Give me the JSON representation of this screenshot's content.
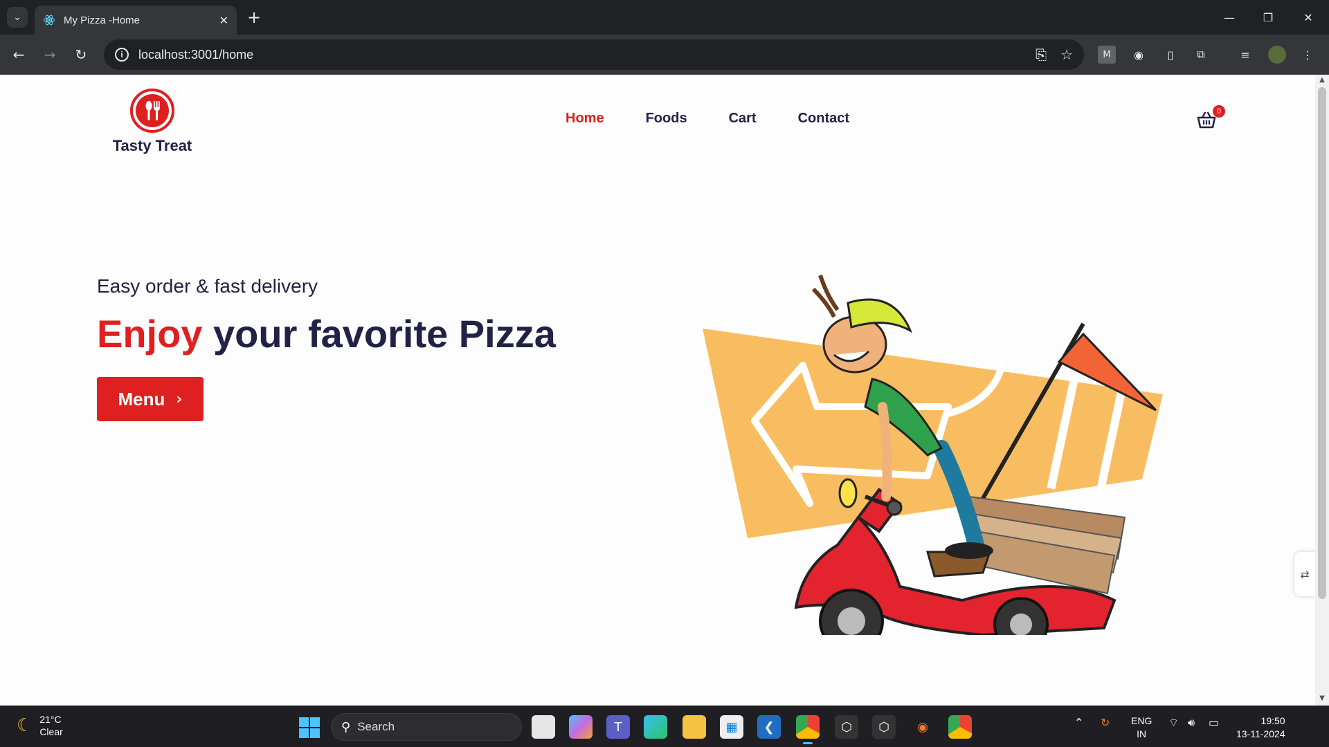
{
  "browser": {
    "tab_title": "My Pizza -Home",
    "url": "localhost:3001/home"
  },
  "site": {
    "logo_text": "Tasty Treat",
    "nav": [
      {
        "label": "Home",
        "active": true
      },
      {
        "label": "Foods",
        "active": false
      },
      {
        "label": "Cart",
        "active": false
      },
      {
        "label": "Contact",
        "active": false
      }
    ],
    "cart_count": "0",
    "accent_color": "#df2020",
    "text_color": "#212245"
  },
  "hero": {
    "subtitle": "Easy order & fast delivery",
    "title_highlight": "Enjoy",
    "title_rest": "your favorite Pizza",
    "button_label": "Menu",
    "illustration": "pizza-delivery-scooter"
  },
  "taskbar": {
    "weather_temp": "21°C",
    "weather_desc": "Clear",
    "search_label": "Search",
    "lang_primary": "ENG",
    "lang_secondary": "IN",
    "time": "19:50",
    "date": "13-11-2024"
  }
}
